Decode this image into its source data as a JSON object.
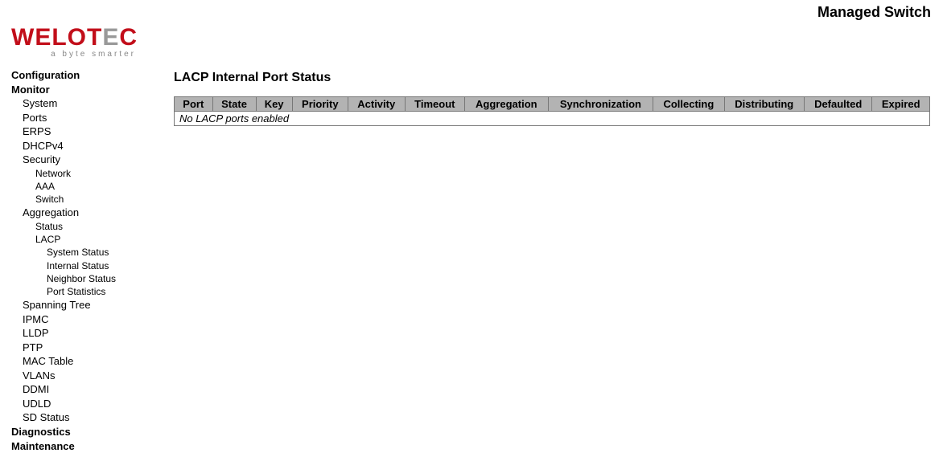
{
  "header": {
    "title": "Managed Switch",
    "logo_main": "WELOTEC",
    "logo_tagline": "a byte smarter"
  },
  "nav": [
    {
      "label": "Configuration",
      "level": 0
    },
    {
      "label": "Monitor",
      "level": 0
    },
    {
      "label": "System",
      "level": 1
    },
    {
      "label": "Ports",
      "level": 1
    },
    {
      "label": "ERPS",
      "level": 1
    },
    {
      "label": "DHCPv4",
      "level": 1
    },
    {
      "label": "Security",
      "level": 1
    },
    {
      "label": "Network",
      "level": 2
    },
    {
      "label": "AAA",
      "level": 2
    },
    {
      "label": "Switch",
      "level": 2
    },
    {
      "label": "Aggregation",
      "level": 1
    },
    {
      "label": "Status",
      "level": 2
    },
    {
      "label": "LACP",
      "level": 2
    },
    {
      "label": "System Status",
      "level": 3
    },
    {
      "label": "Internal Status",
      "level": 3
    },
    {
      "label": "Neighbor Status",
      "level": 3
    },
    {
      "label": "Port Statistics",
      "level": 3
    },
    {
      "label": "Spanning Tree",
      "level": 1
    },
    {
      "label": "IPMC",
      "level": 1
    },
    {
      "label": "LLDP",
      "level": 1
    },
    {
      "label": "PTP",
      "level": 1
    },
    {
      "label": "MAC Table",
      "level": 1
    },
    {
      "label": "VLANs",
      "level": 1
    },
    {
      "label": "DDMI",
      "level": 1
    },
    {
      "label": "UDLD",
      "level": 1
    },
    {
      "label": "SD Status",
      "level": 1
    },
    {
      "label": "Diagnostics",
      "level": 0
    },
    {
      "label": "Maintenance",
      "level": 0
    }
  ],
  "page": {
    "title": "LACP Internal Port Status"
  },
  "table": {
    "columns": [
      "Port",
      "State",
      "Key",
      "Priority",
      "Activity",
      "Timeout",
      "Aggregation",
      "Synchronization",
      "Collecting",
      "Distributing",
      "Defaulted",
      "Expired"
    ],
    "empty_message": "No LACP ports enabled"
  }
}
